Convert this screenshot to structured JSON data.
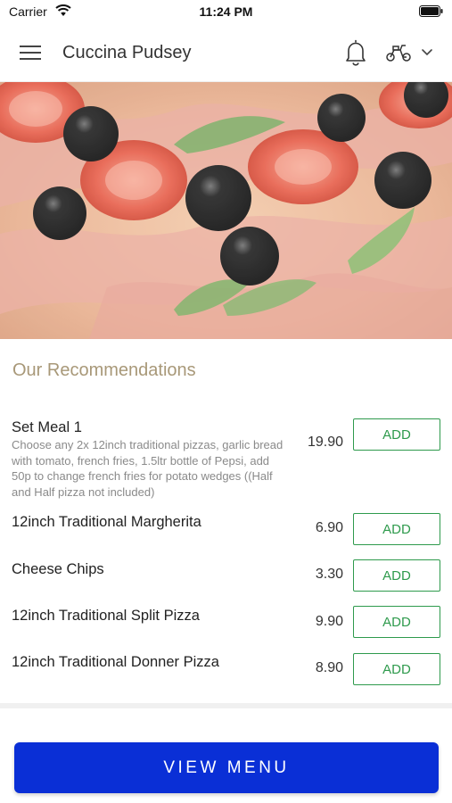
{
  "status_bar": {
    "carrier": "Carrier",
    "time": "11:24 PM"
  },
  "header": {
    "title": "Cuccina Pudsey",
    "icons": [
      "menu-icon",
      "bell-icon",
      "scooter-icon",
      "chevron-down-icon"
    ]
  },
  "recommendations": {
    "title": "Our Recommendations",
    "items": [
      {
        "name": "Set Meal 1",
        "description": "Choose any 2x 12inch traditional pizzas, garlic bread with tomato, french fries, 1.5ltr bottle of Pepsi, add 50p to change french fries for potato wedges ((Half and Half pizza not included)",
        "price": "19.90",
        "button": "ADD"
      },
      {
        "name": "12inch Traditional Margherita",
        "price": "6.90",
        "button": "ADD"
      },
      {
        "name": "Cheese Chips",
        "price": "3.30",
        "button": "ADD"
      },
      {
        "name": "12inch Traditional Split Pizza",
        "price": "9.90",
        "button": "ADD"
      },
      {
        "name": "12inch Traditional Donner Pizza",
        "price": "8.90",
        "button": "ADD"
      }
    ]
  },
  "footer": {
    "view_menu": "VIEW MENU"
  },
  "colors": {
    "accent_blue": "#0a2fd6",
    "add_green": "#2e9a4c",
    "section_title": "#a89878"
  }
}
